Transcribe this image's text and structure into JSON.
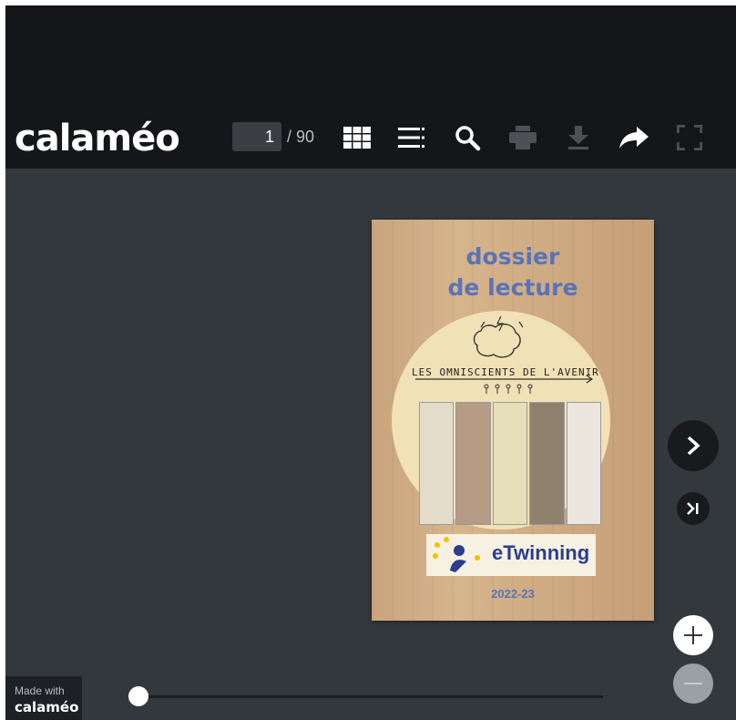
{
  "header": {
    "logo_text": "calaméo",
    "page": {
      "current": "1",
      "total": "/ 90"
    },
    "tools": [
      {
        "name": "grid-view-icon"
      },
      {
        "name": "table-of-contents-icon"
      },
      {
        "name": "search-icon"
      },
      {
        "name": "print-icon"
      },
      {
        "name": "download-icon"
      },
      {
        "name": "share-icon"
      },
      {
        "name": "fullscreen-icon"
      }
    ]
  },
  "document": {
    "title_line1": "dossier",
    "title_line2": "de lecture",
    "banner": "LES OMNISCIENTS DE L'AVENIR",
    "badge": "eTwinning",
    "year": "2022-23"
  },
  "footer": {
    "made_with": "Made with",
    "brand": "calaméo",
    "slider_progress": 0.0
  },
  "colors": {
    "toolbar_bg": "#14161a",
    "stage_bg": "#33383c",
    "logo_accent": "#8dc63f",
    "cover_title": "#5a73b8"
  }
}
